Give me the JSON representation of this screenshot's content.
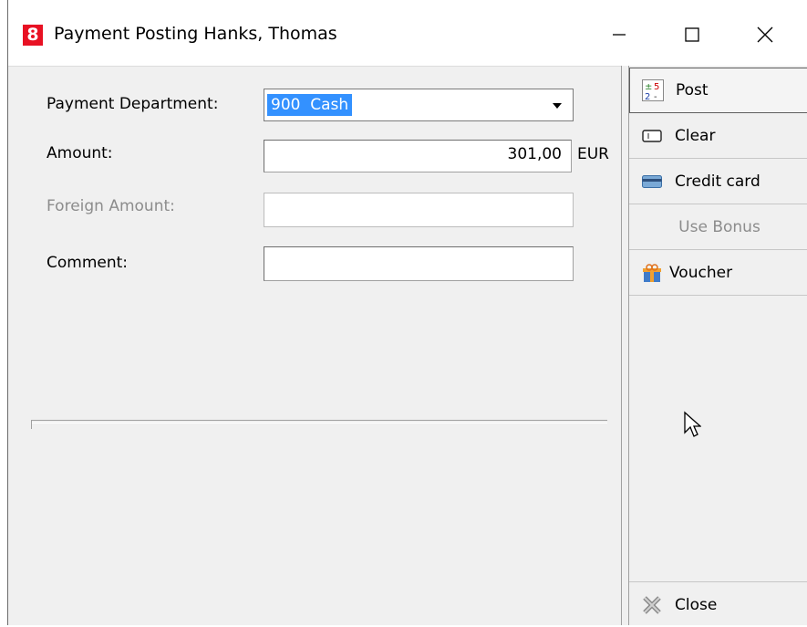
{
  "window": {
    "app_icon_text": "8",
    "title": "Payment Posting Hanks, Thomas"
  },
  "form": {
    "payment_department_label": "Payment Department:",
    "payment_department_value": "900  Cash",
    "amount_label": "Amount:",
    "amount_value": "301,00",
    "currency": "EUR",
    "foreign_amount_label": "Foreign Amount:",
    "foreign_amount_value": "",
    "comment_label": "Comment:",
    "comment_value": ""
  },
  "sidebar": {
    "post_label": "Post",
    "clear_label": "Clear",
    "credit_card_label": "Credit card",
    "use_bonus_label": "Use Bonus",
    "voucher_label": "Voucher",
    "close_label": "Close"
  },
  "icons": {
    "app": "app-logo-icon",
    "minimize": "minimize-icon",
    "maximize": "maximize-icon",
    "close": "close-icon",
    "post": "post-calculator-icon",
    "clear": "clear-eraser-icon",
    "credit_card": "credit-card-icon",
    "voucher": "gift-voucher-icon",
    "close_action": "close-cross-icon",
    "dropdown": "chevron-down-icon",
    "cursor": "mouse-pointer-icon"
  },
  "colors": {
    "app_icon": "#e81123",
    "selection": "#3391ff",
    "window_bg": "#f0f0f0",
    "disabled_text": "#8c8c8c"
  }
}
